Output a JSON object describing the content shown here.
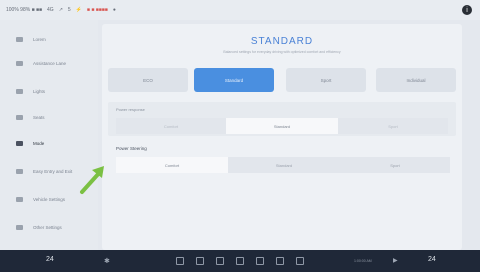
{
  "status_bar": {
    "items": [
      "100% 98% ■ ■■",
      "4G",
      "↗",
      "5",
      "⚡",
      "■ ■ ■■■■",
      "●"
    ],
    "profile_icon": "info-icon"
  },
  "sidebar": {
    "items": [
      {
        "label": "Lorem",
        "icon": "display-icon"
      },
      {
        "label": "Assistance Lane",
        "icon": "assist-icon"
      },
      {
        "label": "Lights",
        "icon": "lights-icon"
      },
      {
        "label": "Seats",
        "icon": "seat-icon"
      },
      {
        "label": "Mode",
        "icon": "drive-mode-icon",
        "active": true
      },
      {
        "label": "Easy Entry and Exit",
        "icon": "entry-icon"
      },
      {
        "label": "Vehicle Settings",
        "icon": "vehicle-icon"
      },
      {
        "label": "Other Settings",
        "icon": "other-icon"
      }
    ]
  },
  "main": {
    "title": "STANDARD",
    "subtitle": "Balanced settings for everyday driving with optimized comfort and efficiency",
    "modes": [
      "ECO",
      "Standard",
      "Sport",
      "Individual"
    ],
    "active_mode": "Standard",
    "section1": {
      "label": "Power response",
      "options": [
        "Comfort",
        "Standard",
        "Sport"
      ],
      "selected": "Standard"
    },
    "section2": {
      "label": "Power Steering",
      "options": [
        "Comfort",
        "Standard",
        "Sport"
      ],
      "selected": "Comfort"
    }
  },
  "bottom_bar": {
    "left_temp": "24",
    "right_temp": "24",
    "media_text": "1:00:00 AM",
    "dock_icons": [
      "home-icon",
      "grid-icon",
      "car-icon",
      "phone-icon",
      "navigation-icon",
      "camera-icon",
      "settings-icon"
    ]
  },
  "colors": {
    "accent": "#4a8fe0",
    "annotation_arrow": "#7bc043",
    "bottom_bar": "#1f2838"
  }
}
